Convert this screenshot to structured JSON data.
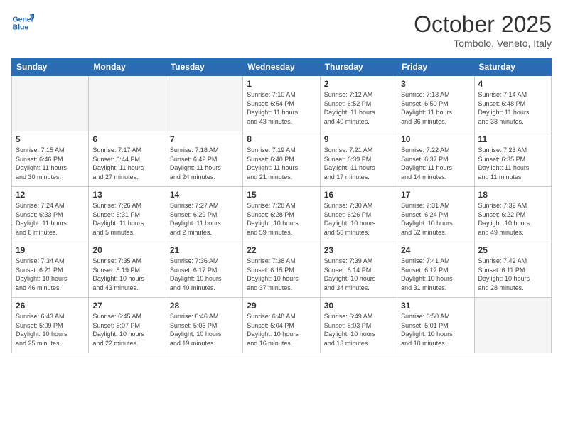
{
  "header": {
    "logo_line1": "General",
    "logo_line2": "Blue",
    "title": "October 2025",
    "subtitle": "Tombolo, Veneto, Italy"
  },
  "days_of_week": [
    "Sunday",
    "Monday",
    "Tuesday",
    "Wednesday",
    "Thursday",
    "Friday",
    "Saturday"
  ],
  "weeks": [
    [
      {
        "day": "",
        "info": ""
      },
      {
        "day": "",
        "info": ""
      },
      {
        "day": "",
        "info": ""
      },
      {
        "day": "1",
        "info": "Sunrise: 7:10 AM\nSunset: 6:54 PM\nDaylight: 11 hours\nand 43 minutes."
      },
      {
        "day": "2",
        "info": "Sunrise: 7:12 AM\nSunset: 6:52 PM\nDaylight: 11 hours\nand 40 minutes."
      },
      {
        "day": "3",
        "info": "Sunrise: 7:13 AM\nSunset: 6:50 PM\nDaylight: 11 hours\nand 36 minutes."
      },
      {
        "day": "4",
        "info": "Sunrise: 7:14 AM\nSunset: 6:48 PM\nDaylight: 11 hours\nand 33 minutes."
      }
    ],
    [
      {
        "day": "5",
        "info": "Sunrise: 7:15 AM\nSunset: 6:46 PM\nDaylight: 11 hours\nand 30 minutes."
      },
      {
        "day": "6",
        "info": "Sunrise: 7:17 AM\nSunset: 6:44 PM\nDaylight: 11 hours\nand 27 minutes."
      },
      {
        "day": "7",
        "info": "Sunrise: 7:18 AM\nSunset: 6:42 PM\nDaylight: 11 hours\nand 24 minutes."
      },
      {
        "day": "8",
        "info": "Sunrise: 7:19 AM\nSunset: 6:40 PM\nDaylight: 11 hours\nand 21 minutes."
      },
      {
        "day": "9",
        "info": "Sunrise: 7:21 AM\nSunset: 6:39 PM\nDaylight: 11 hours\nand 17 minutes."
      },
      {
        "day": "10",
        "info": "Sunrise: 7:22 AM\nSunset: 6:37 PM\nDaylight: 11 hours\nand 14 minutes."
      },
      {
        "day": "11",
        "info": "Sunrise: 7:23 AM\nSunset: 6:35 PM\nDaylight: 11 hours\nand 11 minutes."
      }
    ],
    [
      {
        "day": "12",
        "info": "Sunrise: 7:24 AM\nSunset: 6:33 PM\nDaylight: 11 hours\nand 8 minutes."
      },
      {
        "day": "13",
        "info": "Sunrise: 7:26 AM\nSunset: 6:31 PM\nDaylight: 11 hours\nand 5 minutes."
      },
      {
        "day": "14",
        "info": "Sunrise: 7:27 AM\nSunset: 6:29 PM\nDaylight: 11 hours\nand 2 minutes."
      },
      {
        "day": "15",
        "info": "Sunrise: 7:28 AM\nSunset: 6:28 PM\nDaylight: 10 hours\nand 59 minutes."
      },
      {
        "day": "16",
        "info": "Sunrise: 7:30 AM\nSunset: 6:26 PM\nDaylight: 10 hours\nand 56 minutes."
      },
      {
        "day": "17",
        "info": "Sunrise: 7:31 AM\nSunset: 6:24 PM\nDaylight: 10 hours\nand 52 minutes."
      },
      {
        "day": "18",
        "info": "Sunrise: 7:32 AM\nSunset: 6:22 PM\nDaylight: 10 hours\nand 49 minutes."
      }
    ],
    [
      {
        "day": "19",
        "info": "Sunrise: 7:34 AM\nSunset: 6:21 PM\nDaylight: 10 hours\nand 46 minutes."
      },
      {
        "day": "20",
        "info": "Sunrise: 7:35 AM\nSunset: 6:19 PM\nDaylight: 10 hours\nand 43 minutes."
      },
      {
        "day": "21",
        "info": "Sunrise: 7:36 AM\nSunset: 6:17 PM\nDaylight: 10 hours\nand 40 minutes."
      },
      {
        "day": "22",
        "info": "Sunrise: 7:38 AM\nSunset: 6:15 PM\nDaylight: 10 hours\nand 37 minutes."
      },
      {
        "day": "23",
        "info": "Sunrise: 7:39 AM\nSunset: 6:14 PM\nDaylight: 10 hours\nand 34 minutes."
      },
      {
        "day": "24",
        "info": "Sunrise: 7:41 AM\nSunset: 6:12 PM\nDaylight: 10 hours\nand 31 minutes."
      },
      {
        "day": "25",
        "info": "Sunrise: 7:42 AM\nSunset: 6:11 PM\nDaylight: 10 hours\nand 28 minutes."
      }
    ],
    [
      {
        "day": "26",
        "info": "Sunrise: 6:43 AM\nSunset: 5:09 PM\nDaylight: 10 hours\nand 25 minutes."
      },
      {
        "day": "27",
        "info": "Sunrise: 6:45 AM\nSunset: 5:07 PM\nDaylight: 10 hours\nand 22 minutes."
      },
      {
        "day": "28",
        "info": "Sunrise: 6:46 AM\nSunset: 5:06 PM\nDaylight: 10 hours\nand 19 minutes."
      },
      {
        "day": "29",
        "info": "Sunrise: 6:48 AM\nSunset: 5:04 PM\nDaylight: 10 hours\nand 16 minutes."
      },
      {
        "day": "30",
        "info": "Sunrise: 6:49 AM\nSunset: 5:03 PM\nDaylight: 10 hours\nand 13 minutes."
      },
      {
        "day": "31",
        "info": "Sunrise: 6:50 AM\nSunset: 5:01 PM\nDaylight: 10 hours\nand 10 minutes."
      },
      {
        "day": "",
        "info": ""
      }
    ]
  ]
}
